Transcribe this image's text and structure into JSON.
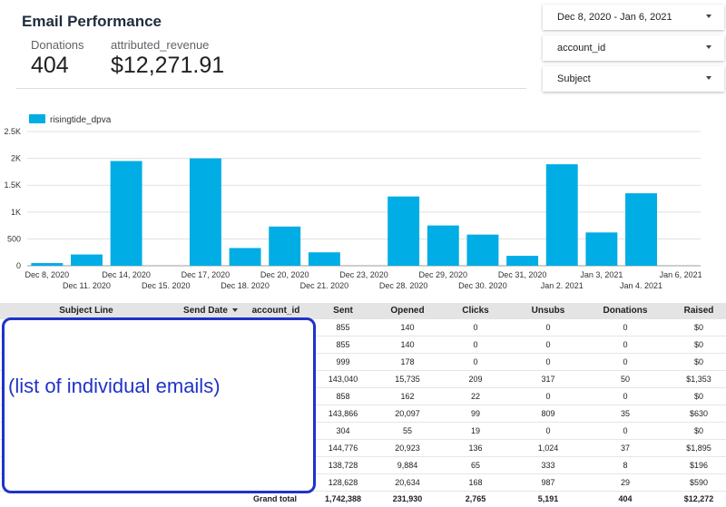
{
  "header": {
    "title": "Email Performance",
    "metrics": [
      {
        "label": "Donations",
        "value": "404"
      },
      {
        "label": "attributed_revenue",
        "value": "$12,271.91"
      }
    ]
  },
  "filters": [
    {
      "label": "Dec 8, 2020 - Jan 6, 2021"
    },
    {
      "label": "account_id"
    },
    {
      "label": "Subject"
    }
  ],
  "chart_data": {
    "type": "bar",
    "series": [
      {
        "name": "risingtide_dpva",
        "color": "#00ade4",
        "x": [
          "Dec 8, 2020",
          "Dec 11, 2020",
          "Dec 14, 2020",
          "Dec 15, 2020",
          "Dec 17, 2020",
          "Dec 18, 2020",
          "Dec 20, 2020",
          "Dec 21, 2020",
          "Dec 23, 2020",
          "Dec 28, 2020",
          "Dec 29, 2020",
          "Dec 30, 2020",
          "Dec 31, 2020",
          "Jan 2, 2021",
          "Jan 3, 2021",
          "Jan 4, 2021",
          "Jan 6, 2021"
        ],
        "values": [
          50,
          210,
          1950,
          0,
          2000,
          330,
          730,
          250,
          0,
          1290,
          750,
          580,
          185,
          1890,
          620,
          1350,
          0
        ]
      }
    ],
    "ylim": [
      0,
      2500
    ],
    "yticks": [
      "0",
      "500",
      "1K",
      "1.5K",
      "2K",
      "2.5K"
    ],
    "ytick_values": [
      0,
      500,
      1000,
      1500,
      2000,
      2500
    ],
    "grid": true,
    "legend": "top-left"
  },
  "table": {
    "columns": [
      "Subject Line",
      "Send Date",
      "account_id",
      "Sent",
      "Opened",
      "Clicks",
      "Unsubs",
      "Donations",
      "Raised"
    ],
    "rows": [
      [
        "855",
        "140",
        "0",
        "0",
        "0",
        "$0"
      ],
      [
        "855",
        "140",
        "0",
        "0",
        "0",
        "$0"
      ],
      [
        "999",
        "178",
        "0",
        "0",
        "0",
        "$0"
      ],
      [
        "143,040",
        "15,735",
        "209",
        "317",
        "50",
        "$1,353"
      ],
      [
        "858",
        "162",
        "22",
        "0",
        "0",
        "$0"
      ],
      [
        "143,866",
        "20,097",
        "99",
        "809",
        "35",
        "$630"
      ],
      [
        "304",
        "55",
        "19",
        "0",
        "0",
        "$0"
      ],
      [
        "144,776",
        "20,923",
        "136",
        "1,024",
        "37",
        "$1,895"
      ],
      [
        "138,728",
        "9,884",
        "65",
        "333",
        "8",
        "$196"
      ],
      [
        "128,628",
        "20,634",
        "168",
        "987",
        "29",
        "$590"
      ]
    ],
    "total_label": "Grand total",
    "totals": [
      "1,742,388",
      "231,930",
      "2,765",
      "5,191",
      "404",
      "$12,272"
    ]
  },
  "annotation": {
    "text": "(list of individual emails)",
    "color": "#1f33c9"
  }
}
